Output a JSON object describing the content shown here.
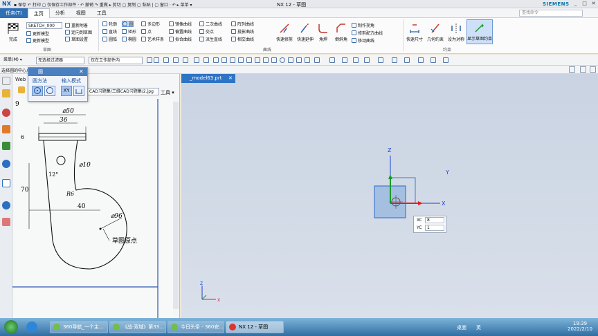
{
  "titlebar": {
    "logo": "NX",
    "quick": "▪ 保存  ↶ 打印  ▢ 仅保存工作部件  ·  ↶ 撤销  ↷ 重做  ▸ 剪切  ▢ 复制  ▢ 粘贴  |  ▢ 窗口 ·  ↶  ▸  菜单 ▾",
    "title": "NX 12 - 草图",
    "brand": "SIEMENS",
    "min": "_",
    "max": "□",
    "close": "✕"
  },
  "menu": {
    "tabs": [
      "任务(T)",
      "主页",
      "分析",
      "视图",
      "工具"
    ],
    "search_placeholder": "查找命令"
  },
  "ribbon": {
    "sketch_name": "SKETCH_000",
    "finish": "完成",
    "sketch_group": "草图",
    "items": [
      "更新模型",
      "定向到草图",
      "重新附着",
      "定向到模型",
      "草图设置",
      "更新模型"
    ],
    "curve": [
      "轮廓",
      "圆",
      "直线",
      "矩形",
      "圆弧",
      "椭圆",
      "多边形",
      "点",
      "艺术样条",
      "镜像曲线",
      "偏置曲线",
      "拟合曲线",
      "二次曲线",
      "交点",
      "派生直线",
      "阵列曲线",
      "投影曲线",
      "相交曲线"
    ],
    "curve_group": "曲线",
    "edit": [
      "快速修剪",
      "快速延伸",
      "角焊",
      "倒斜角",
      "制作拐角",
      "修剪配方曲线",
      "移动曲线"
    ],
    "constraint": [
      "快速尺寸",
      "几何约束",
      "设为对称",
      "显示草图约束"
    ],
    "constraint_group": "约束"
  },
  "toolbar2": {
    "menu_btn": "菜单(M) ▾",
    "filter": "无选择过滤器",
    "scope": "仅在工作部件内"
  },
  "hint": "选择圆的中心点",
  "left_tabs": [
    "Web"
  ],
  "webpanel": {
    "path": "CAD习题集/三维CAD习题集/2.jpg",
    "tools": "工具 ▾",
    "page_no": "9"
  },
  "dialog": {
    "title": "圆",
    "method": "圆方法",
    "input": "输入模式",
    "btn_xy": "XY"
  },
  "sketch": {
    "d50": "⌀50",
    "d36": "36",
    "d6": "6",
    "d10": "⌀10",
    "a12": "12°",
    "r6": "R6",
    "d70": "70",
    "d40": "40",
    "d96": "⌀96",
    "origin": "草图原点"
  },
  "viewport": {
    "tab": "_model63.prt",
    "tab_close": "✕",
    "x_axis": "X",
    "y_axis": "Y",
    "z_axis": "Z"
  },
  "coord": {
    "xc_label": "XC",
    "xc_value": "8",
    "yc_label": "YC",
    "yc_value": "1"
  },
  "taskbar": {
    "tasks": [
      "360导航_一个主...",
      "《战·双城》第33...",
      "今日头条 - 360安...",
      "NX 12 - 草图"
    ],
    "desktop": "桌面",
    "ime": "英",
    "time": "19:39",
    "date": "2022/2/10"
  },
  "colors": {
    "accent": "#2f6fb6",
    "viewport": "#cfd8e6",
    "axis_x": "#e02020",
    "axis_y": "#1a9a2a",
    "axis_z": "#1a3fd0"
  }
}
